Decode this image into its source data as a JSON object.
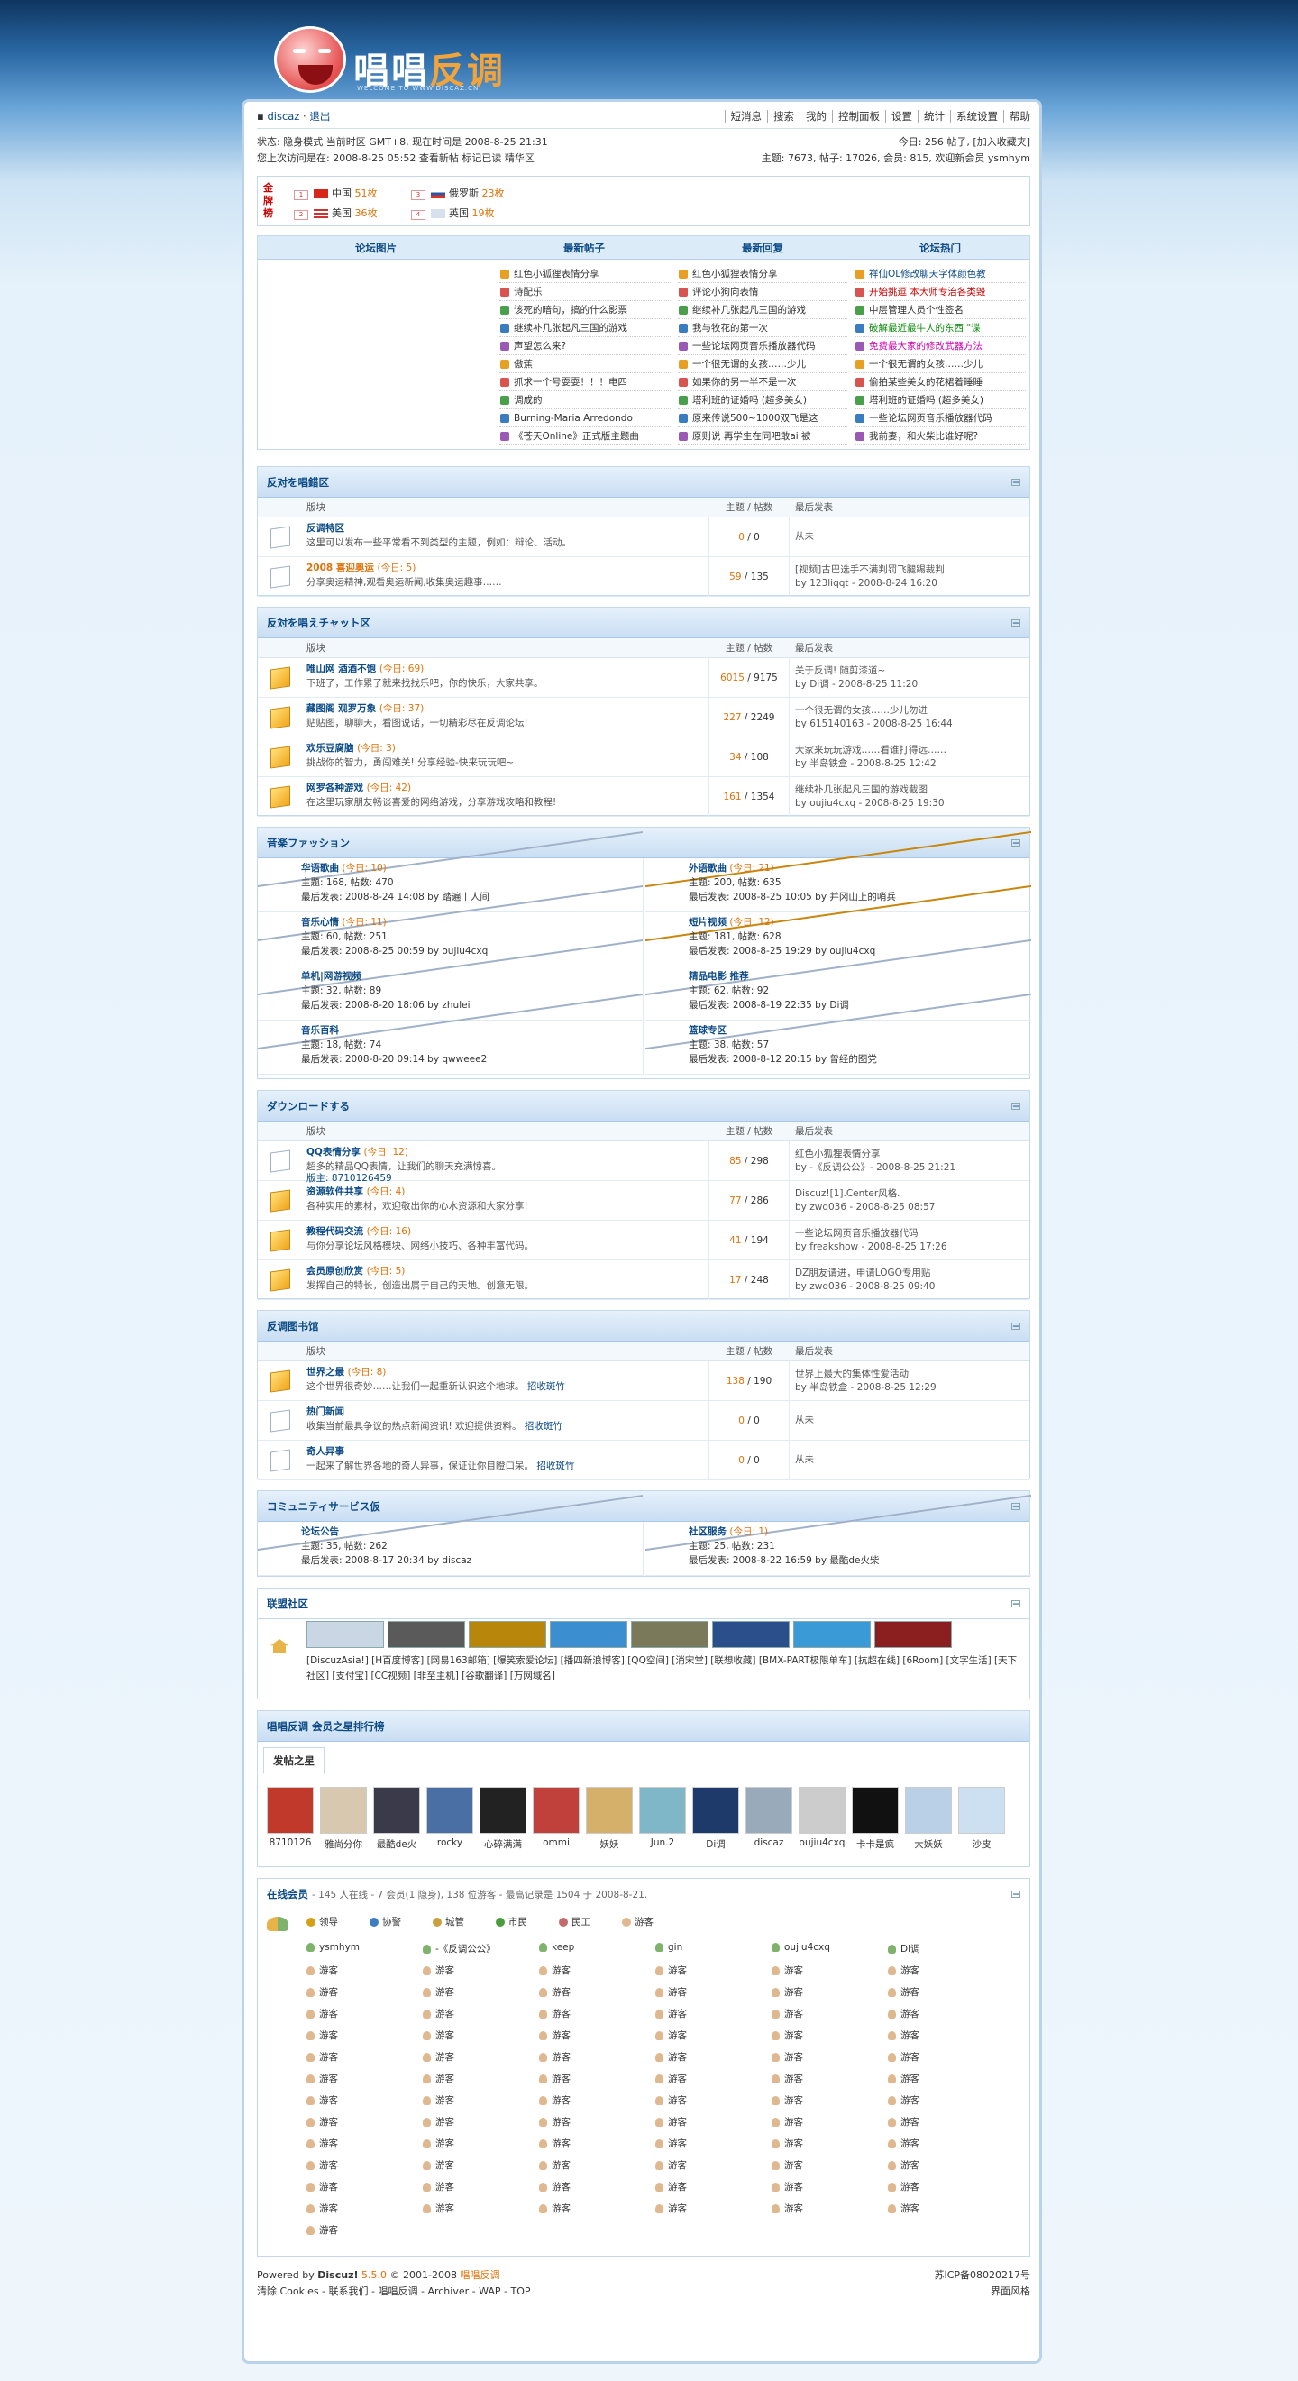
{
  "site": {
    "logo_text_1": "唱唱",
    "logo_text_2": "反调",
    "logo_sub": "WELCOME TO WWW.DISCAZ.CN"
  },
  "topbar": {
    "user": "discaz",
    "logout": "退出",
    "menu": [
      "短消息",
      "搜索",
      "我的",
      "控制面板",
      "设置",
      "统计",
      "系统设置",
      "帮助"
    ]
  },
  "status": {
    "line1": "状态: 隐身模式 当前时区 GMT+8, 现在时间是 2008-8-25 21:31",
    "line2": "您上次访问是在: 2008-8-25 05:52 查看新帖 标记已读 精华区",
    "r1": "今日: 256 帖子, [加入收藏夹]",
    "r2": "主题: 7673, 帖子: 17026, 会员: 815, 欢迎新会员 ysmhym"
  },
  "medal": {
    "label": "金牌榜",
    "items": [
      {
        "n": "1",
        "c": "中国",
        "v": "51枚"
      },
      {
        "n": "2",
        "c": "美国",
        "v": "36枚"
      },
      {
        "n": "3",
        "c": "俄罗斯",
        "v": "23枚"
      },
      {
        "n": "4",
        "c": "英国",
        "v": "19枚"
      }
    ]
  },
  "hot": {
    "heads": [
      "论坛图片",
      "最新帖子",
      "最新回复",
      "论坛热门"
    ],
    "col1": [
      "红色小狐狸表情分享",
      "诗配乐",
      "该死的暗句，搞的什么影票",
      "继续补几张起凡三国的游戏",
      "声望怎么来?",
      "傲蕉",
      "抓求一个号耍耍！！！电四",
      "调成的",
      "Burning-Maria Arredondo",
      "《苍天Online》正式版主题曲"
    ],
    "col2": [
      "红色小狐狸表情分享",
      "评论小狗向表情",
      "继续补几张起凡三国的游戏",
      "我与牧花的第一次",
      "一些论坛网页音乐播放器代码",
      "一个很无谓的女孩……少儿",
      "如果你的另一半不是一次",
      "塔利班的证婚吗 (超多美女)",
      "原来传说500~1000双飞是这",
      "原则说 再学生在同吧敢ai 被"
    ],
    "col3": [
      "祥仙OL修改聊天字体颜色教",
      "开始挑逗 本大师专治各类毁",
      "中层管理人员个性签名",
      "破解最近最牛人的东西 \"谍",
      "免费最大家的修改武器方法",
      "一个很无谓的女孩……少儿",
      "偷拍某些美女的花裙着睡睡",
      "塔利班的证婚吗 (超多美女)",
      "一些论坛网页音乐播放器代码",
      "我前妻，和火柴比谁好呢?"
    ]
  },
  "sections": [
    {
      "title": "反对を唱錯区",
      "cols": [
        "版块",
        "主题 / 帖数",
        "最后发表"
      ],
      "rows": [
        {
          "name": "反调特区",
          "today": "",
          "desc": "这里可以发布一些平常看不到类型的主题，例如：辩论、活动。",
          "t": "0",
          "p": "0",
          "last": "从未",
          "by": "",
          "new": false
        },
        {
          "name": "2008 喜迎奥运",
          "today": "(今日: 5)",
          "desc": "分享奥运精神,观看奥运新闻,收集奥运趣事……",
          "t": "59",
          "p": "135",
          "last": "[视频]古巴选手不满判罚飞腿踢裁判",
          "by": "by 123liqqt - 2008-8-24 16:20",
          "new": false
        }
      ]
    },
    {
      "title": "反対を唱えチャット区",
      "cols": [
        "版块",
        "主题 / 帖数",
        "最后发表"
      ],
      "rows": [
        {
          "name": "唯山网 酒酒不饱",
          "today": "(今日: 69)",
          "desc": "下班了，工作累了就来找找乐吧，你的快乐，大家共享。",
          "t": "6015",
          "p": "9175",
          "last": "关于反调! 随剪漆道~",
          "by": "by Di调 - 2008-8-25 11:20",
          "new": true
        },
        {
          "name": "藏图阁 观罗万象",
          "today": "(今日: 37)",
          "desc": "贴贴图，聊聊天，看图说话，一切精彩尽在反调论坛!",
          "t": "227",
          "p": "2249",
          "last": "一个很无谓的女孩……少儿勿进",
          "by": "by 615140163 - 2008-8-25 16:44",
          "new": true
        },
        {
          "name": "欢乐豆腐脑",
          "today": "(今日: 3)",
          "desc": "挑战你的智力，勇闯难关! 分享经验-快来玩玩吧~",
          "t": "34",
          "p": "108",
          "last": "大家来玩玩游戏……看谁打得远……",
          "by": "by 半岛铁盒 - 2008-8-25 12:42",
          "new": true
        },
        {
          "name": "网罗各种游戏",
          "today": "(今日: 42)",
          "desc": "在这里玩家朋友畅谈喜爱的网络游戏，分享游戏攻略和教程!",
          "t": "161",
          "p": "1354",
          "last": "继续补几张起凡三国的游戏截图",
          "by": "by oujiu4cxq - 2008-8-25 19:30",
          "new": true
        }
      ]
    }
  ],
  "music": {
    "title": "音楽ファッション",
    "cells": [
      {
        "name": "华语歌曲",
        "today": "(今日: 10)",
        "l2": "主题: 168, 帖数: 470",
        "l3": "最后发表: 2008-8-24 14:08 by 踏遍丨人间",
        "new": false
      },
      {
        "name": "外语歌曲",
        "today": "(今日: 21)",
        "l2": "主题: 200, 帖数: 635",
        "l3": "最后发表: 2008-8-25 10:05 by 并冈山上的哨兵",
        "new": true
      },
      {
        "name": "音乐心情",
        "today": "(今日: 11)",
        "l2": "主题: 60, 帖数: 251",
        "l3": "最后发表: 2008-8-25 00:59 by oujiu4cxq",
        "new": false
      },
      {
        "name": "短片视频",
        "today": "(今日: 12)",
        "l2": "主题: 181, 帖数: 628",
        "l3": "最后发表: 2008-8-25 19:29 by oujiu4cxq",
        "new": true
      },
      {
        "name": "单机|网游视频",
        "today": "",
        "l2": "主题: 32, 帖数: 89",
        "l3": "最后发表: 2008-8-20 18:06 by zhulei",
        "new": false
      },
      {
        "name": "精品电影 推荐",
        "today": "",
        "l2": "主题: 62, 帖数: 92",
        "l3": "最后发表: 2008-8-19 22:35 by Di调",
        "new": false
      },
      {
        "name": "音乐百科",
        "today": "",
        "l2": "主题: 18, 帖数: 74",
        "l3": "最后发表: 2008-8-20 09:14 by qwweee2",
        "new": false
      },
      {
        "name": "篮球专区",
        "today": "",
        "l2": "主题: 38, 帖数: 57",
        "l3": "最后发表: 2008-8-12 20:15 by 曾经的图党",
        "new": false
      }
    ]
  },
  "download": {
    "title": "ダウンロードする",
    "cols": [
      "版块",
      "主题 / 帖数",
      "最后发表"
    ],
    "rows": [
      {
        "name": "QQ表情分享",
        "today": "(今日: 12)",
        "desc": "超多的精品QQ表情，让我们的聊天充满惊喜。",
        "mod": "版主: 8710126459",
        "t": "85",
        "p": "298",
        "last": "红色小狐狸表情分享",
        "by": "by -《反调公公》- 2008-8-25 21:21",
        "new": false
      },
      {
        "name": "资源软件共享",
        "today": "(今日: 4)",
        "desc": "各种实用的素材，欢迎敬出你的心水资源和大家分享!",
        "t": "77",
        "p": "286",
        "last": "Discuz![1].Center风格.",
        "by": "by zwq036 - 2008-8-25 08:57",
        "new": true
      },
      {
        "name": "教程代码交流",
        "today": "(今日: 16)",
        "desc": "与你分享论坛风格模块、网络小技巧、各种丰富代码。",
        "t": "41",
        "p": "194",
        "last": "一些论坛网页音乐播放器代码",
        "by": "by freakshow - 2008-8-25 17:26",
        "new": true
      },
      {
        "name": "会员原创欣赏",
        "today": "(今日: 5)",
        "desc": "发挥自己的特长，创造出属于自己的天地。创意无限。",
        "t": "17",
        "p": "248",
        "last": "DZ朋友请进，申请LOGO专用贴",
        "by": "by zwq036 - 2008-8-25 09:40",
        "new": true
      }
    ]
  },
  "library": {
    "title": "反调图书馆",
    "cols": [
      "版块",
      "主题 / 帖数",
      "最后发表"
    ],
    "rows": [
      {
        "name": "世界之最",
        "today": "(今日: 8)",
        "desc": "这个世界很奇妙……让我们一起重新认识这个地球。",
        "link": "招收斑竹",
        "t": "138",
        "p": "190",
        "last": "世界上最大的集体性爱活动",
        "by": "by 半岛铁盒 - 2008-8-25 12:29",
        "new": true
      },
      {
        "name": "热门新闻",
        "today": "",
        "desc": "收集当前最具争议的热点新闻资讯! 欢迎提供资料。",
        "link": "招收斑竹",
        "t": "0",
        "p": "0",
        "last": "从未",
        "by": "",
        "new": false
      },
      {
        "name": "奇人异事",
        "today": "",
        "desc": "一起来了解世界各地的奇人异事，保证让你目瞪口呆。",
        "link": "招收斑竹",
        "t": "0",
        "p": "0",
        "last": "从未",
        "by": "",
        "new": false
      }
    ]
  },
  "community": {
    "title": "コミュニティサービス仮",
    "cells": [
      {
        "name": "论坛公告",
        "today": "",
        "l2": "主题: 35, 帖数: 262",
        "l3": "最后发表: 2008-8-17 20:34 by discaz",
        "new": false
      },
      {
        "name": "社区服务",
        "today": "(今日: 1)",
        "l2": "主题: 25, 帖数: 231",
        "l3": "最后发表: 2008-8-22 16:59 by 最酷de火柴",
        "new": false
      }
    ]
  },
  "links": {
    "title": "联盟社区",
    "logo_colors": [
      "#c9d6e3",
      "#5a5a5a",
      "#b8860b",
      "#3b8fd0",
      "#7a7a5a",
      "#2a4f8a",
      "#3a9ad5",
      "#8b1f1f"
    ],
    "text": "[DiscuzAsia!] [H百度博客] [网易163邮箱] [爆笑索爱论坛] [播四新浪博客] [QQ空间] [消宋堂] [联想收藏] [BMX-PART极限单车] [抗超在线] [6Room] [文字生活] [天下社区] [支付宝] [CC视频] [非至主机] [谷歌翻译] [万网域名]"
  },
  "stars": {
    "title": "唱唱反调 会员之星排行榜",
    "tab": "发帖之星",
    "names": [
      "8710126",
      "雅尚分你",
      "最酷de火",
      "rocky",
      "心碎满满",
      "ommi",
      "妖妖",
      "Jun.2",
      "Di调",
      "discaz",
      "oujiu4cxq",
      "卡卡是疯",
      "大妖妖",
      "沙皮"
    ],
    "colors": [
      "#c0392b",
      "#d9c8b0",
      "#3a3a4a",
      "#4a6fa5",
      "#222",
      "#c0403c",
      "#d4b06a",
      "#7fb7c8",
      "#1e3a6a",
      "#9ab",
      "#ccc",
      "#111",
      "#b9d0e6",
      "#cce0f2"
    ]
  },
  "online": {
    "title": "在线会员",
    "stats": "- 145 人在线 - 7 会员(1 隐身), 138 位游客 - 最高记录是 1504 于 2008-8-21.",
    "legend": [
      "领导",
      "协警",
      "城管",
      "市民",
      "民工",
      "游客"
    ],
    "legend_colors": [
      "#d4a017",
      "#3c7fc0",
      "#c8a040",
      "#4a9c3c",
      "#c46a6a",
      "#e0b890"
    ],
    "members": [
      "ysmhym",
      "-《反调公公》",
      "keep",
      "gin",
      "oujiu4cxq",
      "Di调"
    ],
    "guest": "游客"
  },
  "footer": {
    "powered": "Powered by",
    "brand": "Discuz!",
    "ver": "5.5.0",
    "copy": "© 2001-2008",
    "site": "唱唱反调",
    "icp": "苏ICP备08020217号",
    "l2": "清除 Cookies - 联系我们 - 唱唱反调 - Archiver - WAP - TOP",
    "style": "界面风格"
  }
}
